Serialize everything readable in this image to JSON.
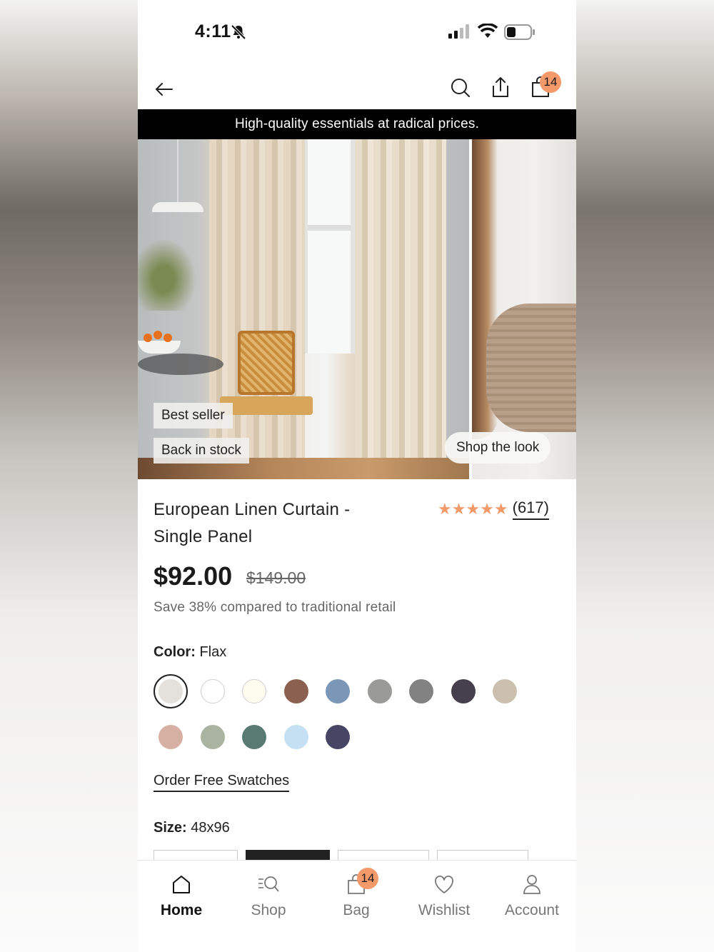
{
  "status_bar": {
    "time": "4:11"
  },
  "header": {
    "cart_count": "14"
  },
  "promo_banner": "High-quality essentials at radical prices.",
  "hero": {
    "tags": [
      "Best seller",
      "Back in stock"
    ],
    "shop_the_look": "Shop the look"
  },
  "product": {
    "title_line1": "European Linen Curtain -",
    "title_line2": "Single Panel",
    "stars": "★★★★★",
    "review_count": "(617)",
    "price": "$92.00",
    "original_price": "$149.00",
    "savings": "Save 38% compared to traditional retail",
    "color_label": "Color:",
    "color_value": "Flax",
    "colors": [
      "#e4e1dc",
      "#ffffff",
      "#fdfcef",
      "#8b6050",
      "#7a97b8",
      "#9a9a98",
      "#828282",
      "#463f4d",
      "#cbbfae",
      "#d6b0a3",
      "#aab3a0",
      "#587a70",
      "#c5dff3",
      "#474564"
    ],
    "order_swatches": "Order Free Swatches",
    "size_label": "Size:",
    "size_value": "48x96"
  },
  "tabbar": {
    "home": "Home",
    "shop": "Shop",
    "bag": "Bag",
    "bag_count": "14",
    "wishlist": "Wishlist",
    "account": "Account"
  }
}
